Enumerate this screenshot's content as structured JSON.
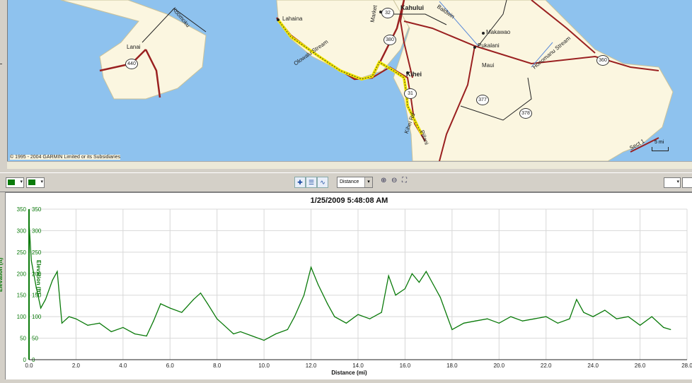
{
  "map": {
    "places": [
      {
        "id": "lahaina",
        "label": "Lahaina"
      },
      {
        "id": "kahului",
        "label": "Kahului"
      },
      {
        "id": "kihei",
        "label": "Kihei"
      },
      {
        "id": "makawao",
        "label": "Makawao"
      },
      {
        "id": "pukalani",
        "label": "Pukalani"
      },
      {
        "id": "lanai",
        "label": "Lanai"
      }
    ],
    "road_labels": [
      "Koomoku",
      "Market",
      "Baldwin",
      "Olowalu Stream",
      "Honomanu Stream",
      "Maui",
      "Kihei Rd",
      "Piilani",
      "Sect 1"
    ],
    "shields": [
      "32",
      "380",
      "31",
      "377",
      "378",
      "360",
      "440"
    ],
    "copyright": "© 1995 - 2004 GARMIN Limited or its Subsidiaries",
    "scale": "5 mi",
    "colors": {
      "water": "#8ec2ee",
      "land": "#fbf6e0",
      "road": "#9a2020",
      "track": "#f2e600"
    }
  },
  "toolbar": {
    "x_axis_mode": "Distance",
    "line_color": "#0a7a0a"
  },
  "chart_data": {
    "type": "line",
    "title": "1/25/2009 5:48:08 AM",
    "xlabel": "Distance (mi)",
    "ylabel": "Elevation (ft)",
    "xlim": [
      0,
      28
    ],
    "ylim": [
      0,
      350
    ],
    "x_ticks": [
      "0.0",
      "2.0",
      "4.0",
      "6.0",
      "8.0",
      "10.0",
      "12.0",
      "14.0",
      "16.0",
      "18.0",
      "20.0",
      "22.0",
      "24.0",
      "26.0",
      "28.0"
    ],
    "y_ticks": [
      "0",
      "50",
      "100",
      "150",
      "200",
      "250",
      "300",
      "350"
    ],
    "grid": true,
    "series": [
      {
        "name": "Elevation (ft)",
        "color": "#0a7a0a",
        "x": [
          0.0,
          0.1,
          0.3,
          0.5,
          0.7,
          1.0,
          1.2,
          1.4,
          1.7,
          2.0,
          2.5,
          3.0,
          3.5,
          4.0,
          4.5,
          5.0,
          5.3,
          5.6,
          6.0,
          6.5,
          7.0,
          7.3,
          7.6,
          8.0,
          8.3,
          8.7,
          9.0,
          9.5,
          10.0,
          10.5,
          11.0,
          11.3,
          11.7,
          12.0,
          12.3,
          12.7,
          13.0,
          13.5,
          14.0,
          14.5,
          15.0,
          15.3,
          15.6,
          16.0,
          16.3,
          16.6,
          16.9,
          17.2,
          17.5,
          17.8,
          18.0,
          18.5,
          19.0,
          19.5,
          20.0,
          20.5,
          21.0,
          21.5,
          22.0,
          22.5,
          23.0,
          23.3,
          23.6,
          24.0,
          24.5,
          25.0,
          25.5,
          26.0,
          26.5,
          27.0,
          27.3
        ],
        "y": [
          320,
          230,
          170,
          120,
          140,
          185,
          205,
          85,
          100,
          95,
          80,
          85,
          65,
          75,
          60,
          55,
          90,
          130,
          120,
          110,
          140,
          155,
          130,
          95,
          80,
          60,
          65,
          55,
          45,
          60,
          70,
          100,
          150,
          215,
          175,
          130,
          100,
          85,
          105,
          95,
          110,
          195,
          150,
          165,
          200,
          180,
          205,
          175,
          145,
          100,
          70,
          85,
          90,
          95,
          85,
          100,
          90,
          95,
          100,
          85,
          95,
          140,
          110,
          100,
          115,
          95,
          100,
          80,
          100,
          75,
          70
        ]
      }
    ]
  }
}
